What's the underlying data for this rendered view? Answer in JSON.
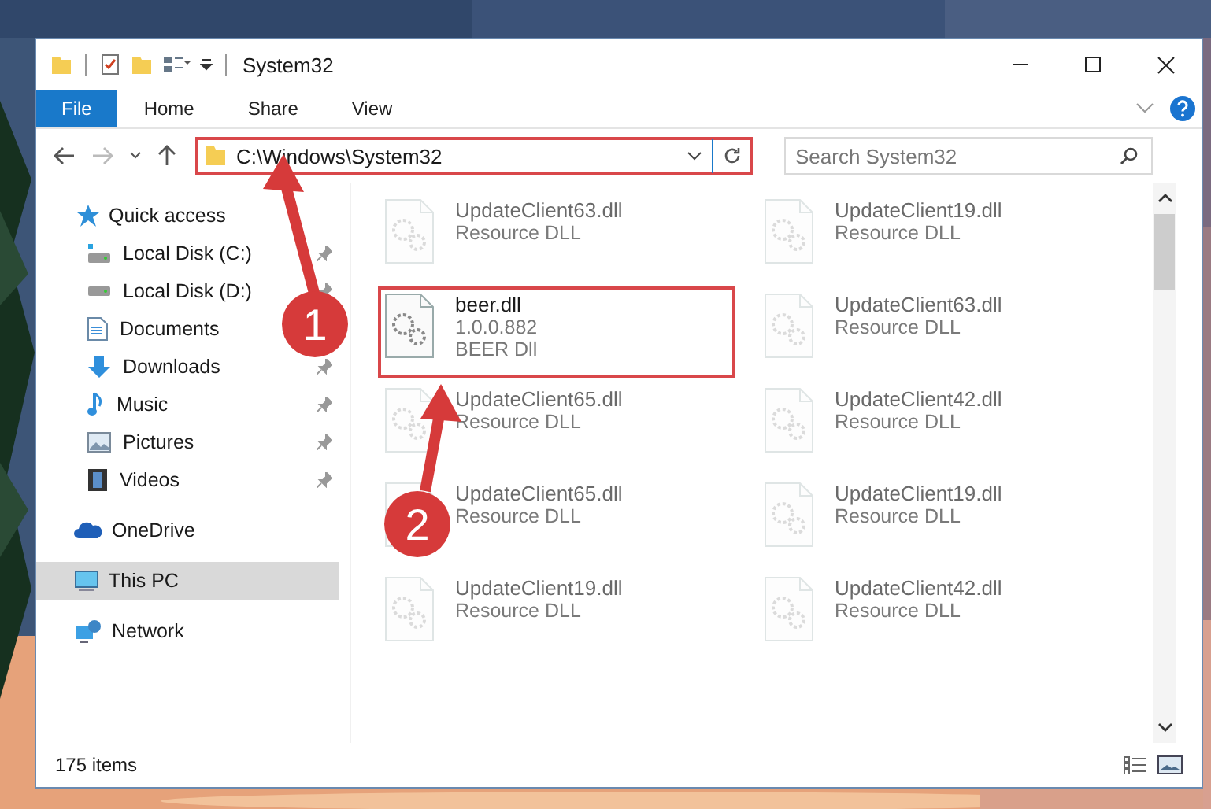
{
  "window": {
    "title": "System32"
  },
  "ribbon": {
    "tabs": [
      {
        "label": "File",
        "selected": true
      },
      {
        "label": "Home",
        "selected": false
      },
      {
        "label": "Share",
        "selected": false
      },
      {
        "label": "View",
        "selected": false
      }
    ]
  },
  "address": {
    "path": "C:\\Windows\\System32",
    "highlighted": true
  },
  "search": {
    "placeholder": "Search System32"
  },
  "sidebar": {
    "items": [
      {
        "label": "Quick access",
        "kind": "star",
        "selected": false,
        "children": [
          {
            "label": "Local Disk (C:)",
            "kind": "disk-c",
            "pinned": true,
            "selected": false
          },
          {
            "label": "Local Disk (D:)",
            "kind": "disk",
            "pinned": true,
            "selected": false
          },
          {
            "label": "Documents",
            "kind": "documents",
            "pinned": false,
            "selected": false
          },
          {
            "label": "Downloads",
            "kind": "downloads",
            "pinned": true,
            "selected": false
          },
          {
            "label": "Music",
            "kind": "music",
            "pinned": true,
            "selected": false
          },
          {
            "label": "Pictures",
            "kind": "pictures",
            "pinned": true,
            "selected": false
          },
          {
            "label": "Videos",
            "kind": "videos",
            "pinned": true,
            "selected": false
          }
        ]
      },
      {
        "label": "OneDrive",
        "kind": "cloud",
        "selected": false
      },
      {
        "label": "This PC",
        "kind": "pc",
        "selected": true
      },
      {
        "label": "Network",
        "kind": "network",
        "selected": false
      }
    ]
  },
  "files": [
    {
      "name": "UpdateClient63.dll",
      "lines": [
        "Resource DLL"
      ],
      "faded": true,
      "highlighted": false
    },
    {
      "name": "UpdateClient19.dll",
      "lines": [
        "Resource DLL"
      ],
      "faded": true,
      "highlighted": false
    },
    {
      "name": "beer.dll",
      "lines": [
        "1.0.0.882",
        "BEER Dll"
      ],
      "faded": false,
      "highlighted": true
    },
    {
      "name": "UpdateClient63.dll",
      "lines": [
        "Resource DLL"
      ],
      "faded": true,
      "highlighted": false
    },
    {
      "name": "UpdateClient65.dll",
      "lines": [
        "Resource DLL"
      ],
      "faded": true,
      "highlighted": false
    },
    {
      "name": "UpdateClient42.dll",
      "lines": [
        "Resource DLL"
      ],
      "faded": true,
      "highlighted": false
    },
    {
      "name": "UpdateClient65.dll",
      "lines": [
        "Resource DLL"
      ],
      "faded": true,
      "highlighted": false
    },
    {
      "name": "UpdateClient19.dll",
      "lines": [
        "Resource DLL"
      ],
      "faded": true,
      "highlighted": false
    },
    {
      "name": "UpdateClient19.dll",
      "lines": [
        "Resource DLL"
      ],
      "faded": true,
      "highlighted": false
    },
    {
      "name": "UpdateClient42.dll",
      "lines": [
        "Resource DLL"
      ],
      "faded": true,
      "highlighted": false
    }
  ],
  "status_bar": {
    "count": "175 items"
  },
  "annotations": [
    {
      "number": "1"
    },
    {
      "number": "2"
    }
  ]
}
